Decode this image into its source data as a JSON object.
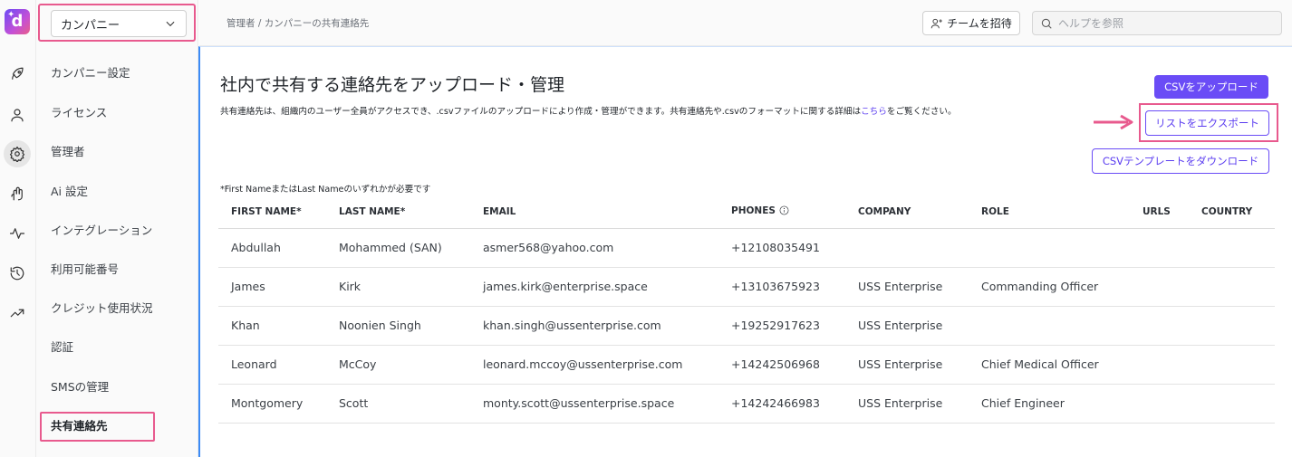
{
  "app": {
    "logo_letter": "d"
  },
  "sidebar": {
    "company_select": "カンパニー",
    "items": [
      {
        "label": "カンパニー設定"
      },
      {
        "label": "ライセンス"
      },
      {
        "label": "管理者"
      },
      {
        "label": "Ai 設定"
      },
      {
        "label": "インテグレーション"
      },
      {
        "label": "利用可能番号"
      },
      {
        "label": "クレジット使用状況"
      },
      {
        "label": "認証"
      },
      {
        "label": "SMSの管理"
      },
      {
        "label": "共有連絡先"
      }
    ],
    "active_item": "共有連絡先"
  },
  "rail_icons": [
    "rocket-icon",
    "user-icon",
    "gear-icon",
    "ai-hand-icon",
    "activity-icon",
    "history-icon",
    "trend-icon"
  ],
  "topbar": {
    "breadcrumb": "管理者 / カンパニーの共有連絡先",
    "invite_label": "チームを招待",
    "help_placeholder": "ヘルプを参照"
  },
  "page": {
    "title": "社内で共有する連絡先をアップロード・管理",
    "description_before_link": "共有連絡先は、組織内のユーザー全員がアクセスでき、.csvファイルのアップロードにより作成・管理ができます。共有連絡先や.csvのフォーマットに関する詳細は",
    "description_link": "こちら",
    "description_after_link": "をご覧ください。",
    "upload_label": "CSVをアップロード",
    "export_label": "リストをエクスポート",
    "template_label": "CSVテンプレートをダウンロード",
    "required_note": "*First NameまたはLast Nameのいずれかが必要です",
    "accent_color": "#6a4cf6",
    "highlight_color": "#e85a8e"
  },
  "table": {
    "headers": {
      "first_name": "FIRST NAME*",
      "last_name": "LAST NAME*",
      "email": "EMAIL",
      "phones": "PHONES",
      "company": "COMPANY",
      "role": "ROLE",
      "urls": "URLS",
      "country": "COUNTRY"
    },
    "rows": [
      {
        "first_name": "Abdullah",
        "last_name": "Mohammed (SAN)",
        "email": "asmer568@yahoo.com",
        "phones": "+12108035491",
        "company": "",
        "role": "",
        "urls": "",
        "country": ""
      },
      {
        "first_name": "James",
        "last_name": "Kirk",
        "email": "james.kirk@enterprise.space",
        "phones": "+13103675923",
        "company": "USS Enterprise",
        "role": "Commanding Officer",
        "urls": "",
        "country": ""
      },
      {
        "first_name": "Khan",
        "last_name": "Noonien Singh",
        "email": "khan.singh@ussenterprise.com",
        "phones": "+19252917623",
        "company": "USS Enterprise",
        "role": "",
        "urls": "",
        "country": ""
      },
      {
        "first_name": "Leonard",
        "last_name": "McCoy",
        "email": "leonard.mccoy@ussenterprise.com",
        "phones": "+14242506968",
        "company": "USS Enterprise",
        "role": "Chief Medical Officer",
        "urls": "",
        "country": ""
      },
      {
        "first_name": "Montgomery",
        "last_name": "Scott",
        "email": "monty.scott@ussenterprise.space",
        "phones": "+14242466983",
        "company": "USS Enterprise",
        "role": "Chief Engineer",
        "urls": "",
        "country": ""
      }
    ]
  }
}
